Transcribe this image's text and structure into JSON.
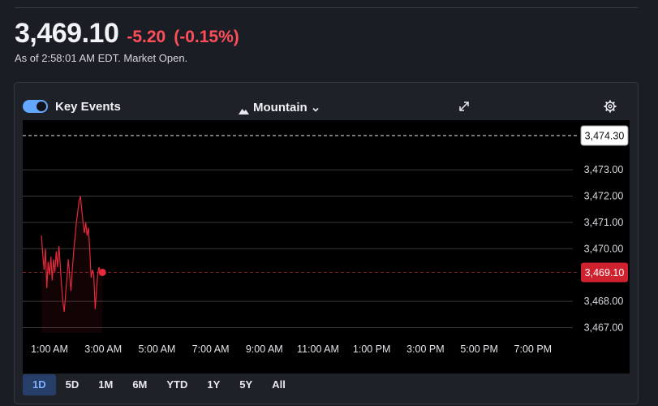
{
  "quote": {
    "price": "3,469.10",
    "change": "-5.20",
    "change_pct": "(-0.15%)",
    "as_of": "As of 2:58:01 AM EDT. Market Open."
  },
  "toolbar": {
    "key_events_label": "Key Events",
    "key_events_on": true,
    "chart_style_label": "Mountain"
  },
  "colors": {
    "down": "#ff4d5a",
    "line": "#e5283a",
    "accent": "#64a7ff",
    "active_range_bg": "#273e68"
  },
  "icons": {
    "chart_style": "mountain-icon",
    "dropdown": "chevron-down-icon",
    "fullscreen": "expand-icon",
    "settings": "gear-icon"
  },
  "ranges": [
    {
      "label": "1D",
      "active": true
    },
    {
      "label": "5D",
      "active": false
    },
    {
      "label": "1M",
      "active": false
    },
    {
      "label": "6M",
      "active": false
    },
    {
      "label": "YTD",
      "active": false
    },
    {
      "label": "1Y",
      "active": false
    },
    {
      "label": "5Y",
      "active": false
    },
    {
      "label": "All",
      "active": false
    }
  ],
  "chart_data": {
    "type": "area",
    "title": "",
    "xlabel": "",
    "ylabel": "",
    "x_ticks": [
      "1:00 AM",
      "3:00 AM",
      "5:00 AM",
      "7:00 AM",
      "9:00 AM",
      "11:00 AM",
      "1:00 PM",
      "3:00 PM",
      "5:00 PM",
      "7:00 PM"
    ],
    "x_tick_hours": [
      1,
      3,
      5,
      7,
      9,
      11,
      13,
      15,
      17,
      19
    ],
    "y_ticks": [
      "3,473.00",
      "3,472.00",
      "3,471.00",
      "3,470.00",
      "3,468.00",
      "3,467.00"
    ],
    "y_tick_values": [
      3473,
      3472,
      3471,
      3470,
      3468,
      3467
    ],
    "ylim": [
      3466.8,
      3474.7
    ],
    "grid": true,
    "previous_close": {
      "value": 3474.3,
      "label": "3,474.30"
    },
    "last_price": {
      "value": 3469.1,
      "label": "3,469.10"
    },
    "series": [
      {
        "x_hours": [
          0.7,
          0.75,
          0.8,
          0.85,
          0.9,
          0.95,
          1.0,
          1.05,
          1.1,
          1.15,
          1.2,
          1.25,
          1.3,
          1.35,
          1.4,
          1.45,
          1.5,
          1.55,
          1.6,
          1.65,
          1.7,
          1.75,
          1.8,
          1.85,
          1.9,
          1.95,
          2.0,
          2.05,
          2.1,
          2.15,
          2.2,
          2.25,
          2.3,
          2.35,
          2.4,
          2.45,
          2.5,
          2.55,
          2.6,
          2.65,
          2.7,
          2.75,
          2.8,
          2.85,
          2.9,
          2.95,
          2.97
        ],
        "values": [
          3470.5,
          3469.8,
          3469.2,
          3470.0,
          3468.5,
          3469.5,
          3469.0,
          3469.7,
          3468.8,
          3469.6,
          3469.1,
          3469.9,
          3469.3,
          3470.1,
          3469.4,
          3468.6,
          3468.0,
          3467.6,
          3468.3,
          3468.9,
          3469.6,
          3469.0,
          3468.4,
          3469.2,
          3469.9,
          3470.4,
          3471.0,
          3471.4,
          3471.8,
          3472.0,
          3471.5,
          3471.0,
          3470.6,
          3471.0,
          3470.5,
          3470.8,
          3469.9,
          3468.9,
          3469.2,
          3469.0,
          3467.7,
          3468.4,
          3469.1,
          3469.3,
          3469.0,
          3469.2,
          3469.1
        ]
      }
    ]
  }
}
